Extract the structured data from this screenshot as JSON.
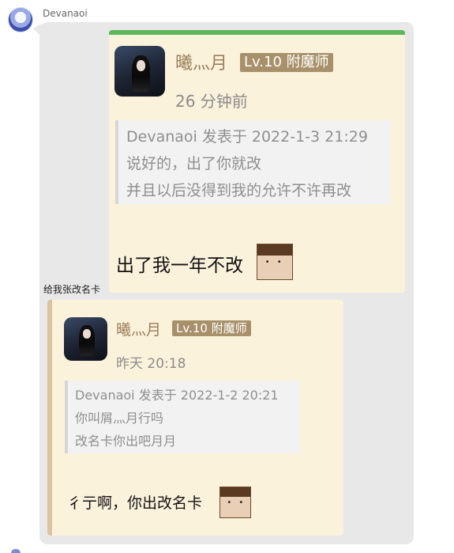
{
  "chat": {
    "sender": "Devanaoi",
    "caption": "给我张改名卡"
  },
  "post1": {
    "username": "曦灬月",
    "level": "Lv.10 附魔师",
    "time": "26 分钟前",
    "quote": {
      "header": "Devanaoi 发表于 2022-1-3 21:29",
      "lines": [
        "说好的，出了你就改",
        "并且以后没得到我的允许不许再改"
      ]
    },
    "reply": "出了我一年不改"
  },
  "post2": {
    "username": "曦灬月",
    "level": "Lv.10 附魔师",
    "time": "昨天 20:18",
    "quote": {
      "header": "Devanaoi 发表于 2022-1-2 20:21",
      "lines": [
        "你叫屑灬月行吗",
        "改名卡你出吧月月"
      ]
    },
    "reply": "彳亍啊，你出改名卡"
  },
  "colors": {
    "card_bg": "#fbf2dc",
    "accent_green": "#5cb85c",
    "badge": "#a8906a",
    "username": "#9a7e5a"
  }
}
